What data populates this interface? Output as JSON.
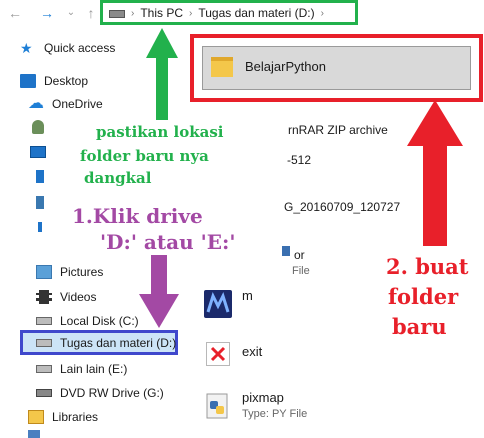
{
  "address_bar": {
    "path": [
      "This PC",
      "Tugas dan materi (D:)"
    ]
  },
  "nav": {
    "items": [
      {
        "label": "Quick access",
        "icon": "star-icon"
      },
      {
        "label": "Desktop",
        "icon": "desktop-icon"
      },
      {
        "label": "OneDrive",
        "icon": "onedrive-icon"
      },
      {
        "label": "Pictures",
        "icon": "pictures-icon"
      },
      {
        "label": "Videos",
        "icon": "videos-icon"
      },
      {
        "label": "Local Disk (C:)",
        "icon": "drive-icon"
      },
      {
        "label": "Tugas dan materi (D:)",
        "icon": "drive-icon"
      },
      {
        "label": "Lain lain (E:)",
        "icon": "drive-icon"
      },
      {
        "label": "DVD RW Drive (G:)",
        "icon": "dvd-drive-icon"
      },
      {
        "label": "Libraries",
        "icon": "libraries-icon"
      }
    ],
    "selected": "Tugas dan materi (D:)"
  },
  "files": {
    "selected_folder": "BelajarPython",
    "partial_rows": [
      "rnRAR ZIP archive",
      "-512",
      "G_20160709_120727",
      "or",
      "File"
    ],
    "rows": [
      {
        "name": "m",
        "type": ""
      },
      {
        "name": "exit",
        "type": ""
      },
      {
        "name": "pixmap",
        "type": "Type: PY File"
      }
    ]
  },
  "annotations": {
    "green": [
      "pastikan lokasi",
      "folder baru nya",
      "dangkal"
    ],
    "purple": [
      "1.Klik drive",
      "'D:' atau 'E:'"
    ],
    "red": [
      "2. buat",
      "folder",
      "baru"
    ]
  },
  "colors": {
    "green": "#22b14c",
    "purple": "#a349a4",
    "red": "#e8202a",
    "blue": "#3f48cc",
    "selection": "#cce4f7"
  }
}
